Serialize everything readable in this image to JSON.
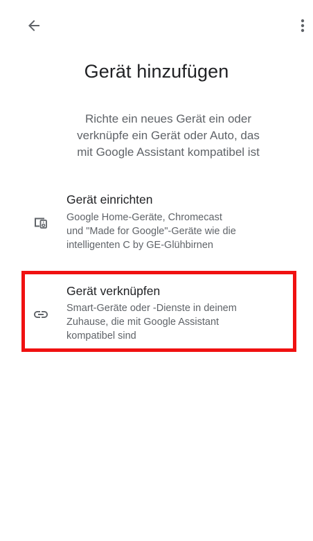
{
  "header": {
    "back_icon": "arrow-back-icon",
    "more_icon": "more-vert-icon"
  },
  "page": {
    "title": "Gerät hinzufügen",
    "subtitle_lines": [
      "Richte ein neues Gerät ein oder",
      "verknüpfe ein Gerät oder Auto, das",
      "mit Google Assistant kompatibel ist"
    ]
  },
  "options": [
    {
      "icon": "device-setup-icon",
      "title": "Gerät einrichten",
      "desc_lines": [
        "Google Home-Geräte, Chromecast",
        "und \"Made for Google\"-Geräte wie die",
        "intelligenten C by GE-Glühbirnen"
      ]
    },
    {
      "icon": "link-icon",
      "title": "Gerät verknüpfen",
      "desc_lines": [
        "Smart-Geräte oder -Dienste in deinem",
        "Zuhause, die mit Google Assistant",
        "kompatibel sind"
      ]
    }
  ],
  "colors": {
    "highlight": "#f01111",
    "text_primary": "#202124",
    "text_secondary": "#5f6368",
    "icon": "#5f6368"
  }
}
